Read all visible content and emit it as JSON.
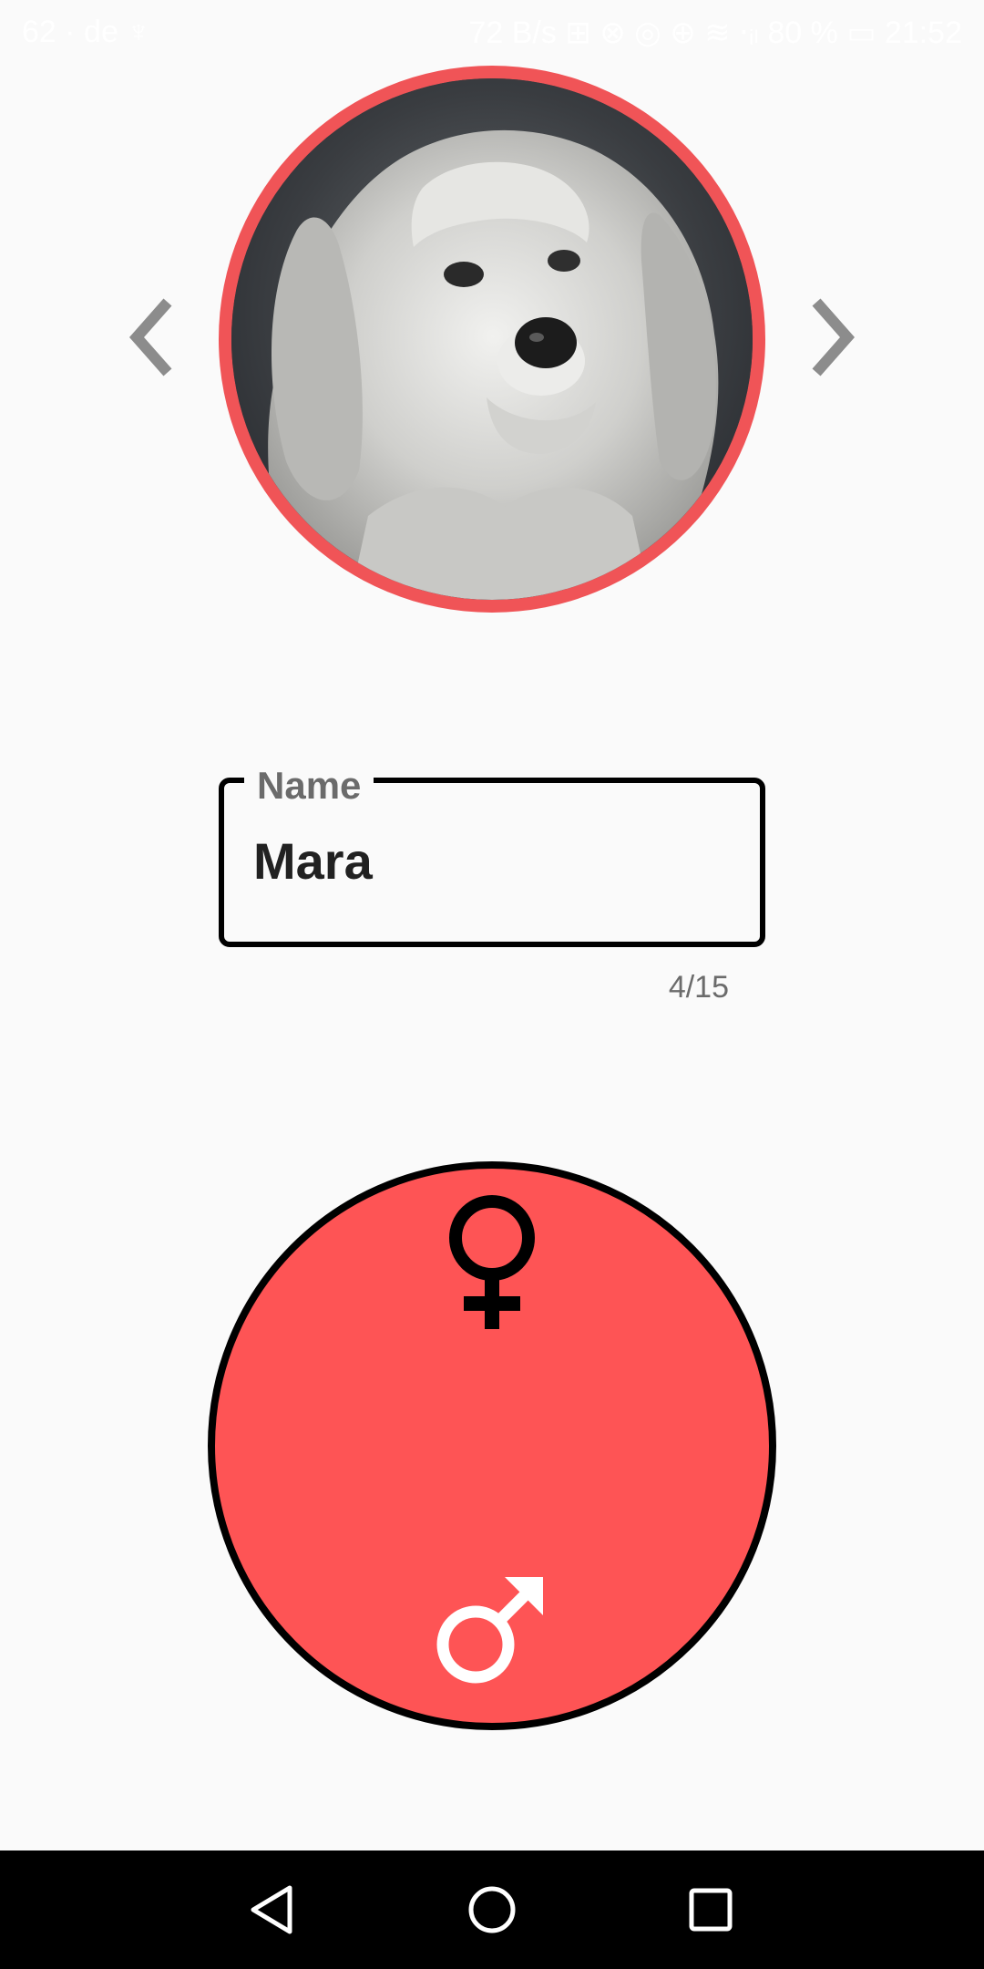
{
  "status_bar": {
    "left_text": "62 · de ♆",
    "right_text": "72 B/s ⊞ ⊗ ◎ ⊕ ≋ ⋅ᵢₗ 80 % ▭ 21:52"
  },
  "photo": {
    "subject": "dog",
    "ring_color": "#f05457"
  },
  "navigation": {
    "prev_icon": "chevron-left",
    "next_icon": "chevron-right"
  },
  "name_field": {
    "label": "Name",
    "value": "Mara",
    "counter": "4/15"
  },
  "gender_selector": {
    "background_color": "#fe5455",
    "female_icon": "female-symbol",
    "male_icon": "male-symbol"
  },
  "system_nav": {
    "back_icon": "back-triangle",
    "home_icon": "home-circle",
    "recents_icon": "recents-square"
  }
}
